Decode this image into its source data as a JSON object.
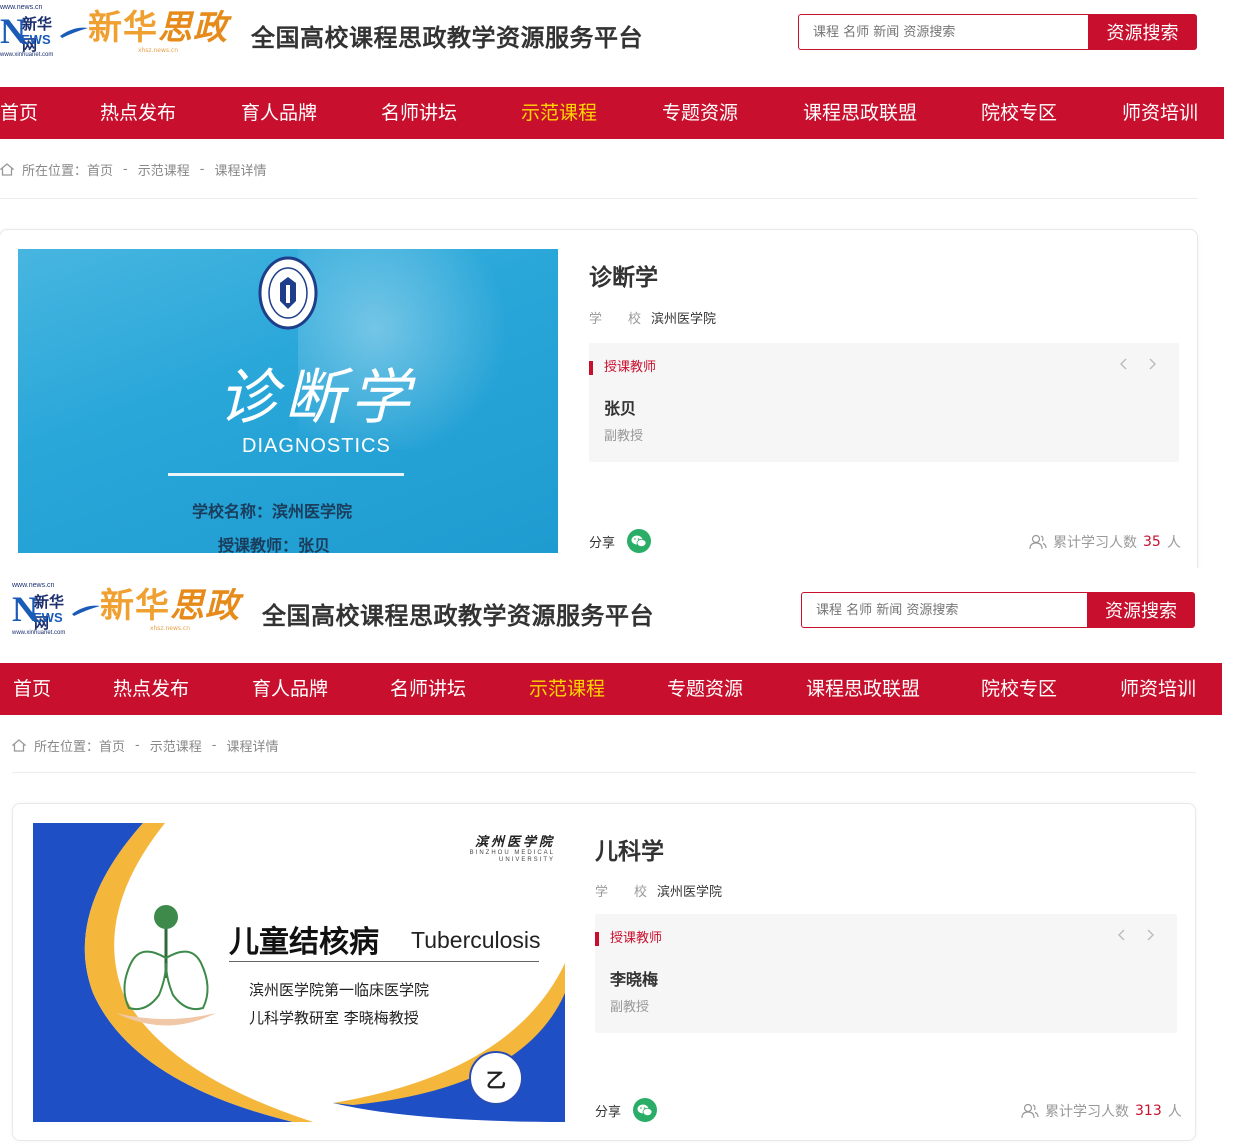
{
  "panels": [
    {
      "header": {
        "xinhua_url": "www.news.cn",
        "xinhua_name": "新华网",
        "xinhua_url2": "www.xinhuanet.com",
        "news_n": "N",
        "news_ews": "EWS",
        "sz_xinhua": "新华",
        "sz_sizheng": "思政",
        "sz_sub": "xhsz.news.cn",
        "site_title": "全国高校课程思政教学资源服务平台",
        "search_placeholder": "课程 名师 新闻 资源搜索",
        "search_button": "资源搜索"
      },
      "nav": [
        "首页",
        "热点发布",
        "育人品牌",
        "名师讲坛",
        "示范课程",
        "专题资源",
        "课程思政联盟",
        "院校专区",
        "师资培训"
      ],
      "nav_active": 4,
      "breadcrumb": {
        "prefix": "所在位置：",
        "items": [
          "首页",
          "示范课程",
          "课程详情"
        ],
        "sep": "-"
      },
      "course": {
        "title": "诊断学",
        "school_label": "学　　校",
        "school": "滨州医学院",
        "teacher_label": "授课教师",
        "teacher_name": "张贝",
        "teacher_rank": "副教授",
        "share_label": "分享",
        "learners_label": "累计学习人数",
        "learners_count": "35",
        "learners_unit": "人",
        "cover": {
          "title": "诊断学",
          "title_en": "DIAGNOSTICS",
          "line1": "学校名称：滨州医学院",
          "line2": "授课教师：张贝"
        }
      }
    },
    {
      "header": {
        "xinhua_url": "www.news.cn",
        "xinhua_name": "新华网",
        "xinhua_url2": "www.xinhuanet.com",
        "news_n": "N",
        "news_ews": "EWS",
        "sz_xinhua": "新华",
        "sz_sizheng": "思政",
        "sz_sub": "xhsz.news.cn",
        "site_title": "全国高校课程思政教学资源服务平台",
        "search_placeholder": "课程 名师 新闻 资源搜索",
        "search_button": "资源搜索"
      },
      "nav": [
        "首页",
        "热点发布",
        "育人品牌",
        "名师讲坛",
        "示范课程",
        "专题资源",
        "课程思政联盟",
        "院校专区",
        "师资培训"
      ],
      "nav_active": 4,
      "breadcrumb": {
        "prefix": "所在位置：",
        "items": [
          "首页",
          "示范课程",
          "课程详情"
        ],
        "sep": "-"
      },
      "course": {
        "title": "儿科学",
        "school_label": "学　　校",
        "school": "滨州医学院",
        "teacher_label": "授课教师",
        "teacher_name": "李晓梅",
        "teacher_rank": "副教授",
        "share_label": "分享",
        "learners_label": "累计学习人数",
        "learners_count": "313",
        "learners_unit": "人",
        "cover": {
          "brand_cn": "滨州医学院",
          "brand_en1": "BINZHOU MEDICAL",
          "brand_en2": "UNIVERSITY",
          "title": "儿童结核病",
          "title_en": "Tuberculosis",
          "line1": "滨州医学院第一临床医学院",
          "line2": "儿科学教研室 李晓梅教授",
          "badge": "乙"
        }
      }
    }
  ],
  "colors": {
    "brand_red": "#c8102e",
    "nav_active": "#ffd700",
    "wechat_green": "#2aae67"
  },
  "icons": [
    "home-icon",
    "chevron-left-icon",
    "chevron-right-icon",
    "wechat-icon",
    "users-icon",
    "university-seal-icon",
    "lungs-tree-icon"
  ]
}
